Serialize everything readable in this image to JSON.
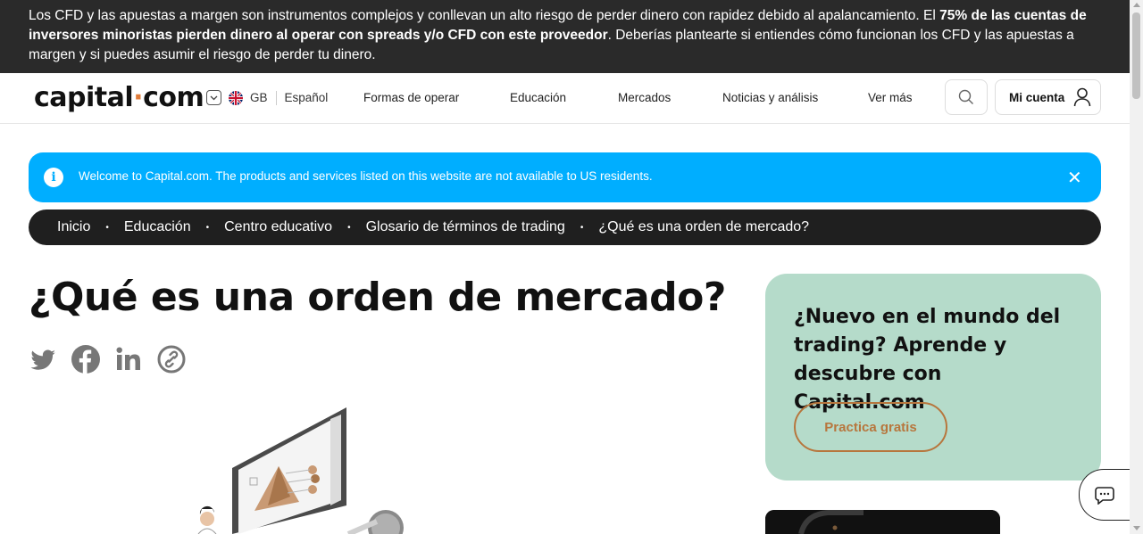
{
  "risk_warning": {
    "part1": "Los CFD y las apuestas a margen son instrumentos complejos y conllevan un alto riesgo de perder dinero con rapidez debido al apalancamiento. El ",
    "bold": "75% de las cuentas de inversores minoristas pierden dinero al operar con spreads y/o CFD con este proveedor",
    "part2": ". Deberías plantearte si entiendes cómo funcionan los CFD y las apuestas a margen y si puedes asumir el riesgo de perder tu dinero."
  },
  "header": {
    "logo_left": "capital",
    "logo_dot": "·",
    "logo_right": "com",
    "region_code": "GB",
    "language": "Español",
    "nav": [
      "Formas de operar",
      "Educación",
      "Mercados",
      "Noticias y análisis",
      "Ver más"
    ],
    "account_label": "Mi cuenta"
  },
  "notice": {
    "icon": "i",
    "message": "Welcome to Capital.com. The products and services listed on this website are not available to US residents.",
    "close": "✕"
  },
  "breadcrumb": [
    "Inicio",
    "Educación",
    "Centro educativo",
    "Glosario de términos de trading",
    "¿Qué es una orden de mercado?"
  ],
  "breadcrumb_separator": "•",
  "page_title": "¿Qué es una orden de mercado?",
  "share_icons": [
    "twitter-icon",
    "facebook-icon",
    "linkedin-icon",
    "copy-link-icon"
  ],
  "promo": {
    "title": "¿Nuevo en el mundo del trading? Aprende y descubre con Capital.com",
    "button": "Practica gratis"
  },
  "colors": {
    "risk_banner_bg": "#2a2a2a",
    "notice_bg": "#00aeff",
    "breadcrumb_bg": "#1f1f1f",
    "promo_bg": "#b5dbca",
    "promo_button": "#b7763d",
    "logo_dot": "#e07b39"
  }
}
